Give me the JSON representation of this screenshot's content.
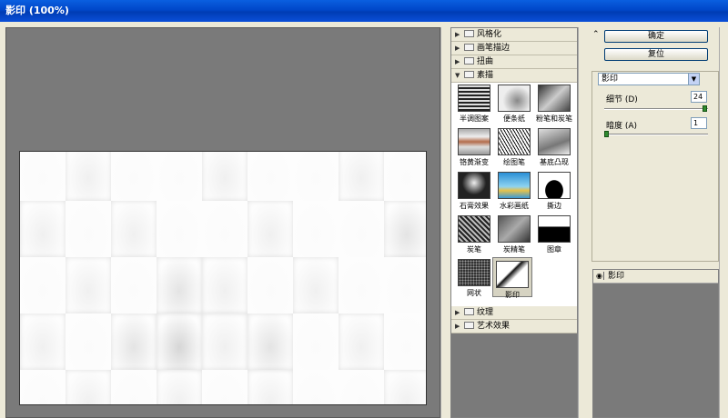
{
  "window": {
    "title": "影印 (100%)"
  },
  "gallery": {
    "categories_top": [
      {
        "label": "风格化",
        "expanded": false
      },
      {
        "label": "画笔描边",
        "expanded": false
      },
      {
        "label": "扭曲",
        "expanded": false
      },
      {
        "label": "素描",
        "expanded": true
      }
    ],
    "thumbnails": [
      {
        "label": "半调图案"
      },
      {
        "label": "便条纸"
      },
      {
        "label": "粉笔和炭笔"
      },
      {
        "label": "铬黄渐变"
      },
      {
        "label": "绘图笔"
      },
      {
        "label": "基底凸现"
      },
      {
        "label": "石膏效果"
      },
      {
        "label": "水彩画纸"
      },
      {
        "label": "撕边"
      },
      {
        "label": "炭笔"
      },
      {
        "label": "炭精笔"
      },
      {
        "label": "图章"
      },
      {
        "label": "网状"
      },
      {
        "label": "影印",
        "selected": true
      }
    ],
    "categories_bottom": [
      {
        "label": "纹理",
        "expanded": false
      },
      {
        "label": "艺术效果",
        "expanded": false
      }
    ]
  },
  "buttons": {
    "ok": "确定",
    "reset": "复位"
  },
  "filter_select": {
    "value": "影印"
  },
  "params": {
    "detail": {
      "label": "细节 (D)",
      "value": "24",
      "fraction": 1.0
    },
    "darkness": {
      "label": "暗度 (A)",
      "value": "1",
      "fraction": 0.0
    }
  },
  "layers": [
    {
      "label": "影印"
    }
  ],
  "colors": {
    "titlebar": "#0047c9",
    "preview_bg": "#7a7a7a",
    "dialog_bg": "#ece9d8"
  }
}
